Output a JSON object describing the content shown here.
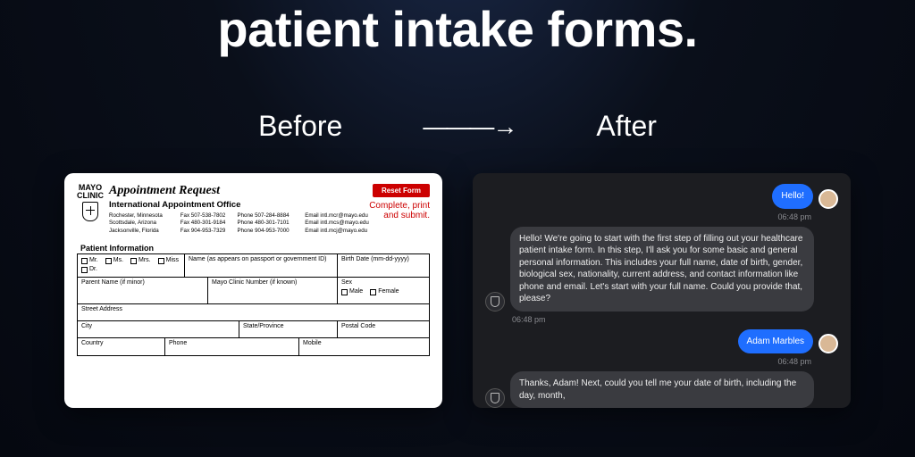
{
  "headline": "patient intake forms.",
  "labels": {
    "before": "Before",
    "after": "After",
    "arrow": "———→"
  },
  "form": {
    "logo": {
      "line1": "MAYO",
      "line2": "CLINIC"
    },
    "title": "Appointment Request",
    "office": "International Appointment Office",
    "locations": [
      {
        "name": "Rochester, Minnesota",
        "fax": "Fax 507-538-7802",
        "phone": "Phone 507-284-8884",
        "email": "Email intl.mcr@mayo.edu"
      },
      {
        "name": "Scottsdale, Arizona",
        "fax": "Fax 480-301-9184",
        "phone": "Phone 480-301-7101",
        "email": "Email intl.mcs@mayo.edu"
      },
      {
        "name": "Jacksonville, Florida",
        "fax": "Fax 904-953-7329",
        "phone": "Phone 904-953-7000",
        "email": "Email intl.mcj@mayo.edu"
      }
    ],
    "reset": "Reset Form",
    "note": "Complete, print and submit.",
    "section": "Patient Information",
    "titles": [
      "Mr.",
      "Ms.",
      "Mrs.",
      "Miss",
      "Dr."
    ],
    "fields": {
      "name": "Name (as appears on passport or government ID)",
      "birth": "Birth Date (mm-dd-yyyy)",
      "parent": "Parent Name (if minor)",
      "mcn": "Mayo Clinic Number (if known)",
      "sex": "Sex",
      "male": "Male",
      "female": "Female",
      "street": "Street Address",
      "city": "City",
      "state": "State/Province",
      "postal": "Postal Code",
      "country": "Country",
      "phone": "Phone",
      "mobile": "Mobile"
    }
  },
  "chat": {
    "msg1": "Hello!",
    "ts1": "06:48 pm",
    "msg2": "Hello! We're going to start with the first step of filling out your healthcare patient intake form. In this step, I'll ask you for some basic and general personal information. This includes your full name, date of birth, gender, biological sex, nationality, current address, and contact information like phone and email. Let's start with your full name. Could you provide that, please?",
    "ts2": "06:48 pm",
    "msg3": "Adam Marbles",
    "ts3": "06:48 pm",
    "msg4": "Thanks, Adam! Next, could you tell me your date of birth, including the day, month,"
  }
}
